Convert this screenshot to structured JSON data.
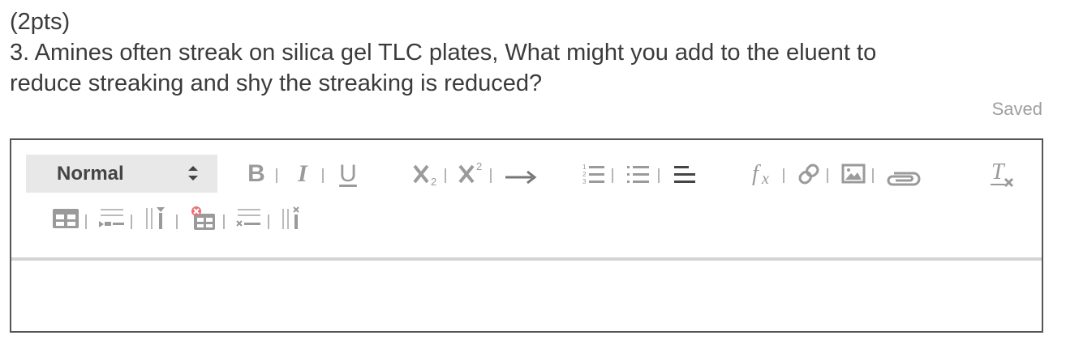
{
  "question": {
    "points": "(2pts)",
    "line1": "3. Amines often streak on silica gel TLC plates, What might you add to the eluent to",
    "line2": "reduce streaking and shy the streaking is reduced?"
  },
  "status": {
    "saved_label": "Saved"
  },
  "editor": {
    "format_select": {
      "value": "Normal"
    },
    "toolbar": {
      "bold_label": "B",
      "italic_label": "I",
      "underline_label": "U",
      "icons": [
        "subscript-icon",
        "superscript-icon",
        "indent-arrow-icon",
        "numbered-list-icon",
        "bulleted-list-icon",
        "align-left-icon",
        "formula-icon",
        "link-icon",
        "image-icon",
        "attachment-icon",
        "clear-formatting-icon",
        "insert-table-icon",
        "insert-row-icon",
        "insert-column-icon",
        "delete-table-icon",
        "delete-row-icon",
        "delete-column-icon"
      ]
    },
    "content_value": ""
  },
  "colors": {
    "icon_gray": "#9a9a9a",
    "active_icon": "#444444",
    "select_background": "#e8e8e8",
    "editor_border": "#555555",
    "toolbar_divider": "#d4d4d4",
    "delete_badge": "#e57373"
  }
}
